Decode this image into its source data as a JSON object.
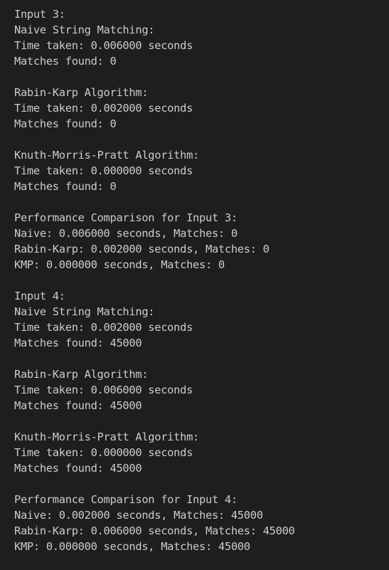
{
  "terminal": {
    "lines": [
      "Input 3:",
      "Naive String Matching:",
      "Time taken: 0.006000 seconds",
      "Matches found: 0",
      "",
      "Rabin-Karp Algorithm:",
      "Time taken: 0.002000 seconds",
      "Matches found: 0",
      "",
      "Knuth-Morris-Pratt Algorithm:",
      "Time taken: 0.000000 seconds",
      "Matches found: 0",
      "",
      "Performance Comparison for Input 3:",
      "Naive: 0.006000 seconds, Matches: 0",
      "Rabin-Karp: 0.002000 seconds, Matches: 0",
      "KMP: 0.000000 seconds, Matches: 0",
      "",
      "Input 4:",
      "Naive String Matching:",
      "Time taken: 0.002000 seconds",
      "Matches found: 45000",
      "",
      "Rabin-Karp Algorithm:",
      "Time taken: 0.006000 seconds",
      "Matches found: 45000",
      "",
      "Knuth-Morris-Pratt Algorithm:",
      "Time taken: 0.000000 seconds",
      "Matches found: 45000",
      "",
      "Performance Comparison for Input 4:",
      "Naive: 0.002000 seconds, Matches: 45000",
      "Rabin-Karp: 0.006000 seconds, Matches: 45000",
      "KMP: 0.000000 seconds, Matches: 45000"
    ]
  }
}
